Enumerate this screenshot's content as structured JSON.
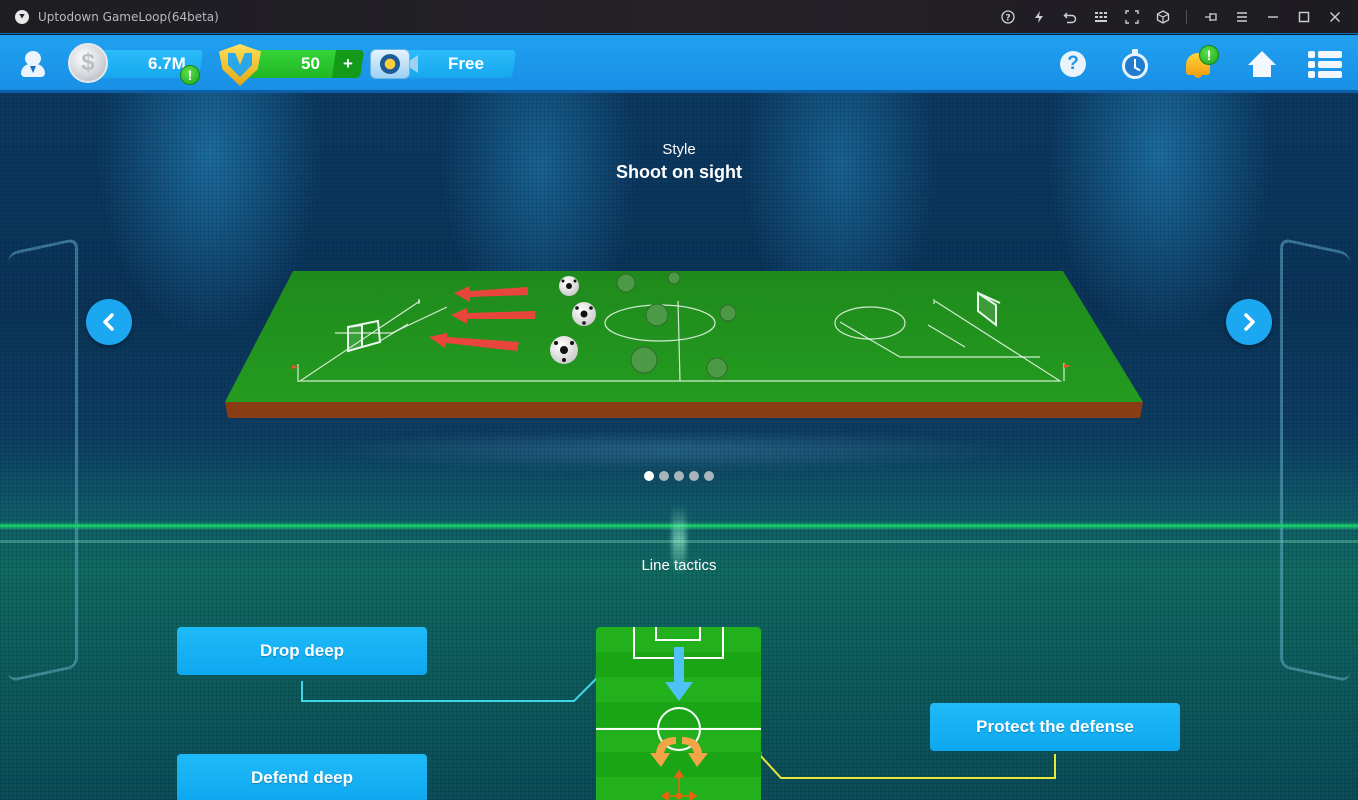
{
  "window": {
    "title": "Uptodown GameLoop(64beta)",
    "controls": [
      {
        "name": "help-icon",
        "glyph": "?"
      },
      {
        "name": "boost-icon",
        "glyph": "⚡"
      },
      {
        "name": "undo-icon",
        "glyph": "↶"
      },
      {
        "name": "keymap-icon",
        "glyph": "⌨"
      },
      {
        "name": "fullscreen-icon",
        "glyph": "⛶"
      },
      {
        "name": "gamepad-icon",
        "glyph": "◈"
      },
      {
        "name": "pin-icon",
        "glyph": "⊣"
      },
      {
        "name": "hamburger-icon",
        "glyph": "☰"
      },
      {
        "name": "minimize-icon",
        "glyph": "—"
      },
      {
        "name": "maximize-icon",
        "glyph": "☐"
      },
      {
        "name": "close-icon",
        "glyph": "✕"
      }
    ]
  },
  "hud": {
    "coins": "6.7M",
    "coins_symbol": "$",
    "coins_alert": "!",
    "gems": "50",
    "gems_add": "+",
    "video_reward": "Free",
    "help": "?",
    "notifications_alert": "!"
  },
  "carousel": {
    "label": "Style",
    "value": "Shoot on sight",
    "page_count": 5,
    "current_page": 1
  },
  "line_tactics": {
    "label": "Line tactics",
    "options": [
      {
        "label": "Drop deep",
        "connector_color": "#3fd6e8"
      },
      {
        "label": "Defend deep"
      },
      {
        "label": "Protect the defense",
        "connector_color": "#e8e83a"
      }
    ]
  },
  "colors": {
    "hud_blue": "#1f9cee",
    "button_blue": "#16b0f4",
    "gem_green": "#2cc82e",
    "pitch_green": "#1fa51b",
    "arrow_red": "#e8463c"
  }
}
